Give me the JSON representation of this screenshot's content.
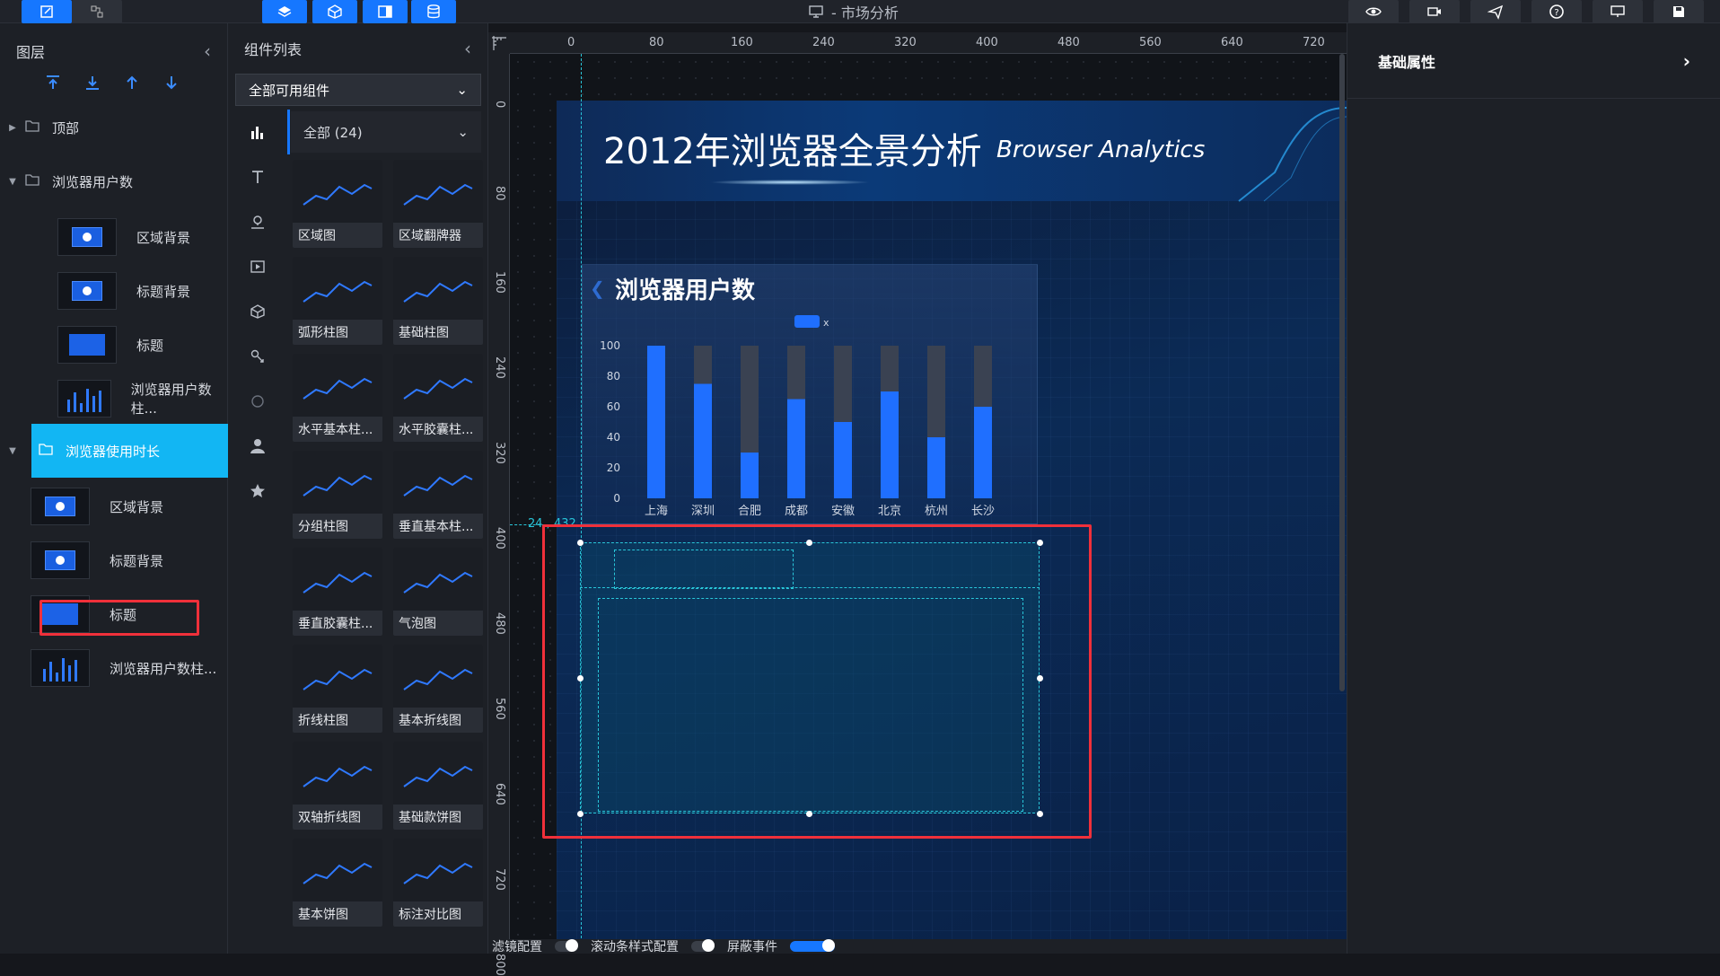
{
  "topbar": {
    "doc_title": "- 市场分析"
  },
  "layers_panel": {
    "title": "图层",
    "folders": [
      {
        "label": "顶部"
      },
      {
        "label": "浏览器用户数"
      },
      {
        "label": "浏览器使用时长"
      }
    ],
    "group1_items": [
      {
        "label": "区域背景"
      },
      {
        "label": "标题背景"
      },
      {
        "label": "标题"
      },
      {
        "label": "浏览器用户数柱..."
      }
    ],
    "group2_items": [
      {
        "label": "区域背景"
      },
      {
        "label": "标题背景"
      },
      {
        "label": "标题"
      },
      {
        "label": "浏览器用户数柱..."
      }
    ]
  },
  "components_panel": {
    "title": "组件列表",
    "filter_value": "全部可用组件",
    "category_value": "全部 (24)",
    "cards": [
      {
        "label": "区域图"
      },
      {
        "label": "区域翻牌器"
      },
      {
        "label": "弧形柱图"
      },
      {
        "label": "基础柱图"
      },
      {
        "label": "水平基本柱..."
      },
      {
        "label": "水平胶囊柱..."
      },
      {
        "label": "分组柱图"
      },
      {
        "label": "垂直基本柱..."
      },
      {
        "label": "垂直胶囊柱..."
      },
      {
        "label": "气泡图"
      },
      {
        "label": "折线柱图"
      },
      {
        "label": "基本折线图"
      },
      {
        "label": "双轴折线图"
      },
      {
        "label": "基础款饼图"
      },
      {
        "label": "基本饼图"
      },
      {
        "label": "标注对比图"
      }
    ]
  },
  "ruler": {
    "top": [
      "0",
      "80",
      "160",
      "240",
      "320",
      "400",
      "480",
      "560",
      "640",
      "720"
    ],
    "left": [
      "0",
      "80",
      "160",
      "240",
      "320",
      "400",
      "480",
      "560",
      "640",
      "720",
      "800"
    ]
  },
  "canvas": {
    "title": "2012年浏览器全景分析",
    "subtitle": "Browser Analytics",
    "guide_label": "24 , 432",
    "panel_title": "浏览器用户数"
  },
  "chart_data": {
    "type": "bar",
    "categories": [
      "上海",
      "深圳",
      "合肥",
      "成都",
      "安徽",
      "北京",
      "杭州",
      "长沙"
    ],
    "series": [
      {
        "name": "x",
        "values": [
          100,
          75,
          30,
          65,
          50,
          70,
          40,
          60
        ]
      }
    ],
    "ylim": [
      0,
      100
    ],
    "yticks": [
      "0",
      "20",
      "40",
      "60",
      "80",
      "100"
    ],
    "background_max": 100,
    "colors": {
      "bar": "#1f6fff",
      "track": "#3a4252"
    }
  },
  "properties_panel": {
    "title": "基础属性"
  },
  "bottombar": {
    "filter_label": "滤镜配置",
    "scroll_label": "滚动条样式配置",
    "mask_label": "屏蔽事件"
  },
  "colors": {
    "accent": "#1677ff",
    "selection": "#29c6d9",
    "highlight_border": "#f0303a",
    "selected_layer": "#12b6f3"
  }
}
